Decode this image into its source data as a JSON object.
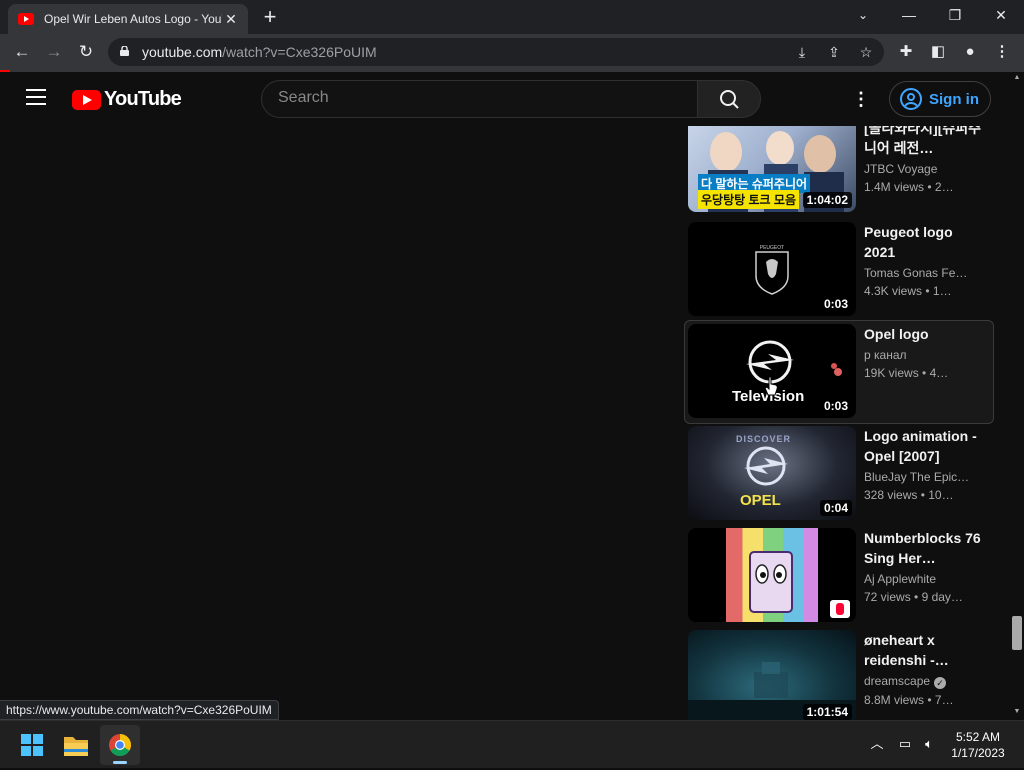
{
  "browser": {
    "tab_title": "Opel Wir Leben Autos Logo - YouTube",
    "url_host": "youtube.com",
    "url_path": "/watch?v=Cxe326PoUIM",
    "status_url": "https://www.youtube.com/watch?v=Cxe326PoUIM"
  },
  "youtube": {
    "logo_text": "YouTube",
    "search_placeholder": "Search",
    "sign_in_label": "Sign in"
  },
  "recommendations": [
    {
      "title": "[올라와라지][슈퍼주니어 레전…",
      "channel": "JTBC Voyage",
      "views": "1.4M views",
      "age": "2…",
      "duration": "1:04:02",
      "thumb_caption_1": "다 말하는 슈퍼주니어",
      "thumb_caption_2": "우당탕탕 토크 모음"
    },
    {
      "title": "Peugeot logo 2021",
      "channel": "Tomas Gonas Fe…",
      "views": "4.3K views",
      "age": "1…",
      "duration": "0:03"
    },
    {
      "title": "Opel logo",
      "channel": "р канал",
      "views": "19K views",
      "age": "4…",
      "duration": "0:03",
      "thumb_text": "Television"
    },
    {
      "title": "Logo animation - Opel [2007]",
      "channel": "BlueJay The Epic…",
      "views": "328 views",
      "age": "10…",
      "duration": "0:04",
      "thumb_text_top": "DISCOVER",
      "thumb_text": "OPEL"
    },
    {
      "title": "Numberblocks 76 Sing Her…",
      "channel": "Aj Applewhite",
      "views": "72 views",
      "age": "9 day…"
    },
    {
      "title": "øneheart x reidenshi -…",
      "channel": "dreamscape",
      "views": "8.8M views",
      "age": "7…",
      "duration": "1:01:54"
    }
  ],
  "taskbar": {
    "time": "5:52 AM",
    "date": "1/17/2023"
  },
  "colors": {
    "youtube_red": "#ff0000",
    "link_blue": "#3ea6ff",
    "page_bg": "#0f0f0f"
  }
}
